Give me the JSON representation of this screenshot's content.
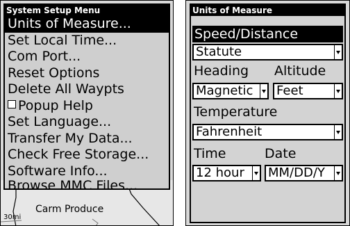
{
  "left_screen": {
    "menu": {
      "title": "System Setup Menu",
      "items": [
        {
          "label": "Units of Measure...",
          "selected": true
        },
        {
          "label": "Set Local Time..."
        },
        {
          "label": "Com Port..."
        },
        {
          "label": "Reset Options"
        },
        {
          "label": "Delete All Waypts"
        },
        {
          "label": "Popup Help",
          "checkbox": true,
          "checked": false
        },
        {
          "label": "Set Language..."
        },
        {
          "label": "Transfer My Data..."
        },
        {
          "label": "Check Free Storage..."
        },
        {
          "label": "Software Info..."
        },
        {
          "label": "Browse MMC Files..."
        }
      ]
    },
    "map": {
      "place_label": "Carm Produce",
      "scale_label": "30mi"
    }
  },
  "right_screen": {
    "title": "Units of Measure",
    "speed_distance": {
      "label": "Speed/Distance",
      "value": "Statute"
    },
    "heading": {
      "label": "Heading",
      "value": "Magnetic"
    },
    "altitude": {
      "label": "Altitude",
      "value": "Feet"
    },
    "temperature": {
      "label": "Temperature",
      "value": "Fahrenheit"
    },
    "time": {
      "label": "Time",
      "value": "12 hour"
    },
    "date": {
      "label": "Date",
      "value": "MM/DD/Y"
    }
  }
}
